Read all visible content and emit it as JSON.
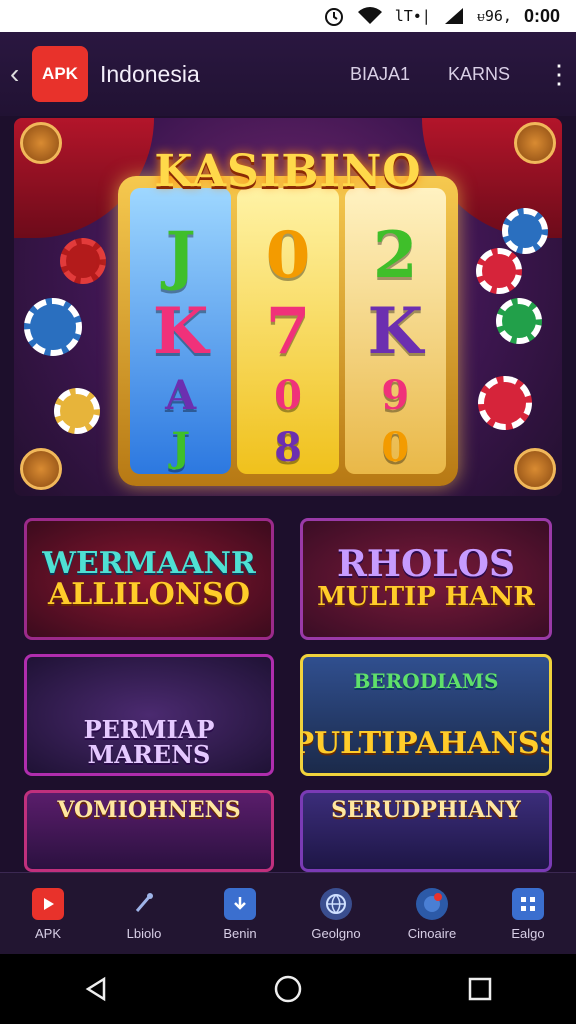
{
  "status_bar": {
    "carrier_text": "lT∙|",
    "signal_text": "ᵾ96,",
    "time": "0:00"
  },
  "app_bar": {
    "back_glyph": "‹",
    "logo_text": "APK",
    "title": "Indonesia",
    "nav_links": [
      "BIAJA1",
      "KARNS"
    ],
    "overflow_glyph": "⋮"
  },
  "hero": {
    "title": "KASIBINO",
    "reels": [
      [
        "J",
        "K",
        "A",
        "J"
      ],
      [
        "0",
        "7",
        "0",
        "8"
      ],
      [
        "2",
        "K",
        "9",
        "0"
      ]
    ]
  },
  "tiles": [
    {
      "line1": "WERMAANR",
      "line2": "ALLILONSO"
    },
    {
      "line1": "RHOLOS",
      "line2": "MULTIP HANR"
    },
    {
      "line1": "",
      "line2": "PERMIAP MARENS"
    },
    {
      "line1": "BERODIAMS",
      "line2": "PULTIPAHANSS"
    },
    {
      "line1": "VOMIOHNENS",
      "line2": ""
    },
    {
      "line1": "SERUDPHIANY",
      "line2": ""
    }
  ],
  "bottom_nav": [
    {
      "label": "APK",
      "icon": "play-icon",
      "color": "#e8322b"
    },
    {
      "label": "Lbiolo",
      "icon": "stylus-icon",
      "color": "#2a1d3f"
    },
    {
      "label": "Benin",
      "icon": "download-icon",
      "color": "#3b6fcf"
    },
    {
      "label": "Geolgno",
      "icon": "globe-icon",
      "color": "#3a4e8f"
    },
    {
      "label": "Cinoaire",
      "icon": "chat-icon",
      "color": "#2c5aa8"
    },
    {
      "label": "Ealgo",
      "icon": "grid-icon",
      "color": "#3b6fcf"
    }
  ],
  "colors": {
    "background": "#1d0f2c",
    "accent_red": "#e8322b",
    "gold": "#ffcc2a"
  }
}
